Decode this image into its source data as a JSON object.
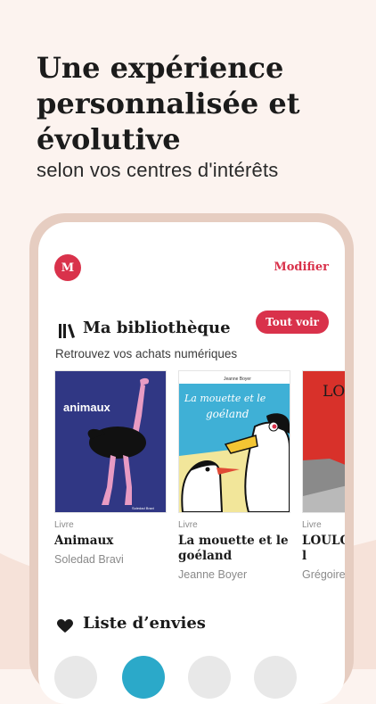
{
  "hero": {
    "title": "Une expérience personnalisée et évolutive",
    "subtitle": "selon vos centres d'intérêts"
  },
  "app": {
    "avatar_letter": "M",
    "edit_label": "Modifier",
    "library": {
      "title": "Ma bibliothèque",
      "see_all_label": "Tout voir",
      "subtitle": "Retrouvez vos achats numériques",
      "books": [
        {
          "type": "Livre",
          "title": "Animaux",
          "author": "Soledad Bravi",
          "cover_title": "animaux",
          "cover_caption": "Soledad Bravi"
        },
        {
          "type": "Livre",
          "title": "La mouette et le goéland",
          "author": "Jeanne Boyer",
          "cover_title_line1": "La mouette et le",
          "cover_title_line2": "goéland",
          "cover_caption": "Jeanne Boyer"
        },
        {
          "type": "Livre",
          "title": "LOULOU que le l",
          "author": "Grégoire",
          "cover_title": "LOU"
        }
      ]
    },
    "wishlist": {
      "title": "Liste d’envies"
    }
  },
  "colors": {
    "accent": "#d9324b",
    "background": "#fcf3ef",
    "phone_frame": "#e6cdc1",
    "tab_active": "#2ba9c9",
    "tab_inactive": "#e8e8e8"
  }
}
